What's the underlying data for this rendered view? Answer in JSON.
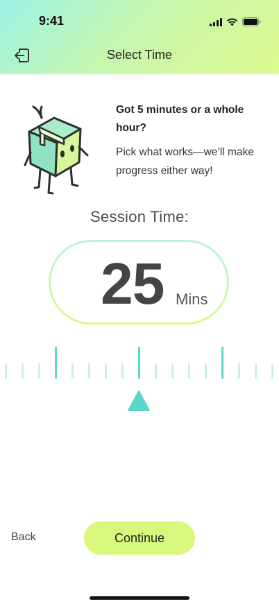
{
  "status_bar": {
    "time": "9:41"
  },
  "header": {
    "title": "Select Time"
  },
  "intro": {
    "heading": "Got 5 minutes or a whole hour?",
    "body": "Pick what works—we’ll make progress either way!"
  },
  "session": {
    "label": "Session Time:",
    "value": "25",
    "unit": "Mins"
  },
  "actions": {
    "back_label": "Back",
    "continue_label": "Continue"
  },
  "colors": {
    "accent_lime": "#d9f77d",
    "accent_teal": "#58d8c9",
    "tick_light": "#c5f3ea"
  }
}
